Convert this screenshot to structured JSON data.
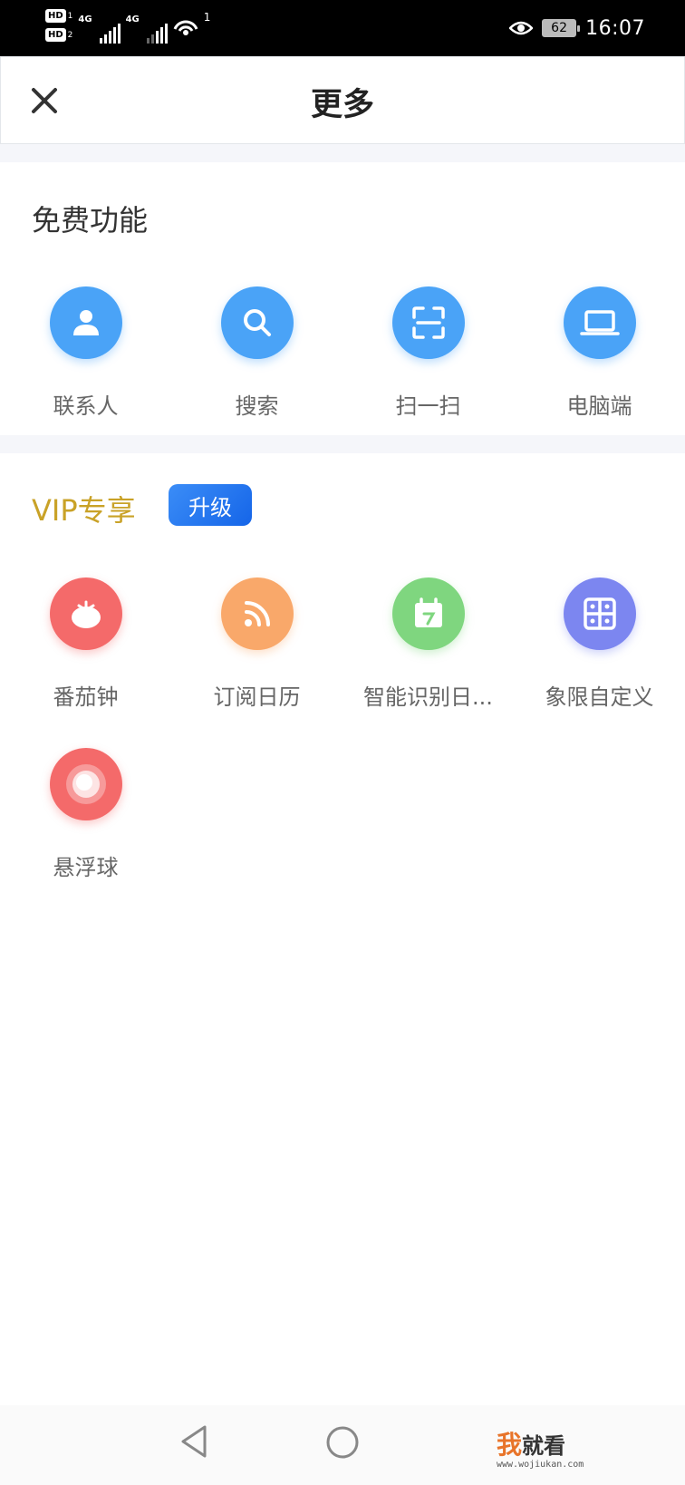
{
  "status_bar": {
    "hd1": "HD",
    "hd1_sub": "1",
    "hd2": "HD",
    "hd2_sub": "2",
    "network1": "4G",
    "network2": "4G",
    "hotspot_count": "1",
    "battery": "62",
    "time": "16:07"
  },
  "header": {
    "title": "更多",
    "close_icon": "close-icon"
  },
  "free_section": {
    "title": "免费功能",
    "items": [
      {
        "label": "联系人",
        "icon": "contact-icon",
        "color": "#4aa3f7"
      },
      {
        "label": "搜索",
        "icon": "search-icon",
        "color": "#4aa3f7"
      },
      {
        "label": "扫一扫",
        "icon": "scan-icon",
        "color": "#4aa3f7"
      },
      {
        "label": "电脑端",
        "icon": "laptop-icon",
        "color": "#4aa3f7"
      }
    ]
  },
  "vip_section": {
    "title": "VIP专享",
    "upgrade_label": "升级",
    "title_color": "#c9a227",
    "items": [
      {
        "label": "番茄钟",
        "icon": "tomato-icon",
        "color": "#f46a6a"
      },
      {
        "label": "订阅日历",
        "icon": "rss-icon",
        "color": "#f9a86a"
      },
      {
        "label": "智能识别日...",
        "icon": "calendar-icon",
        "color": "#7fd67f"
      },
      {
        "label": "象限自定义",
        "icon": "quadrant-icon",
        "color": "#7c86f0"
      },
      {
        "label": "悬浮球",
        "icon": "floating-ball-icon",
        "color": "#f46a6a"
      }
    ]
  },
  "nav_bar": {
    "back_icon": "back-triangle-icon",
    "home_icon": "home-circle-icon"
  },
  "watermark": {
    "char1": "我",
    "rest": "就看",
    "url": "www.wojiukan.com"
  }
}
